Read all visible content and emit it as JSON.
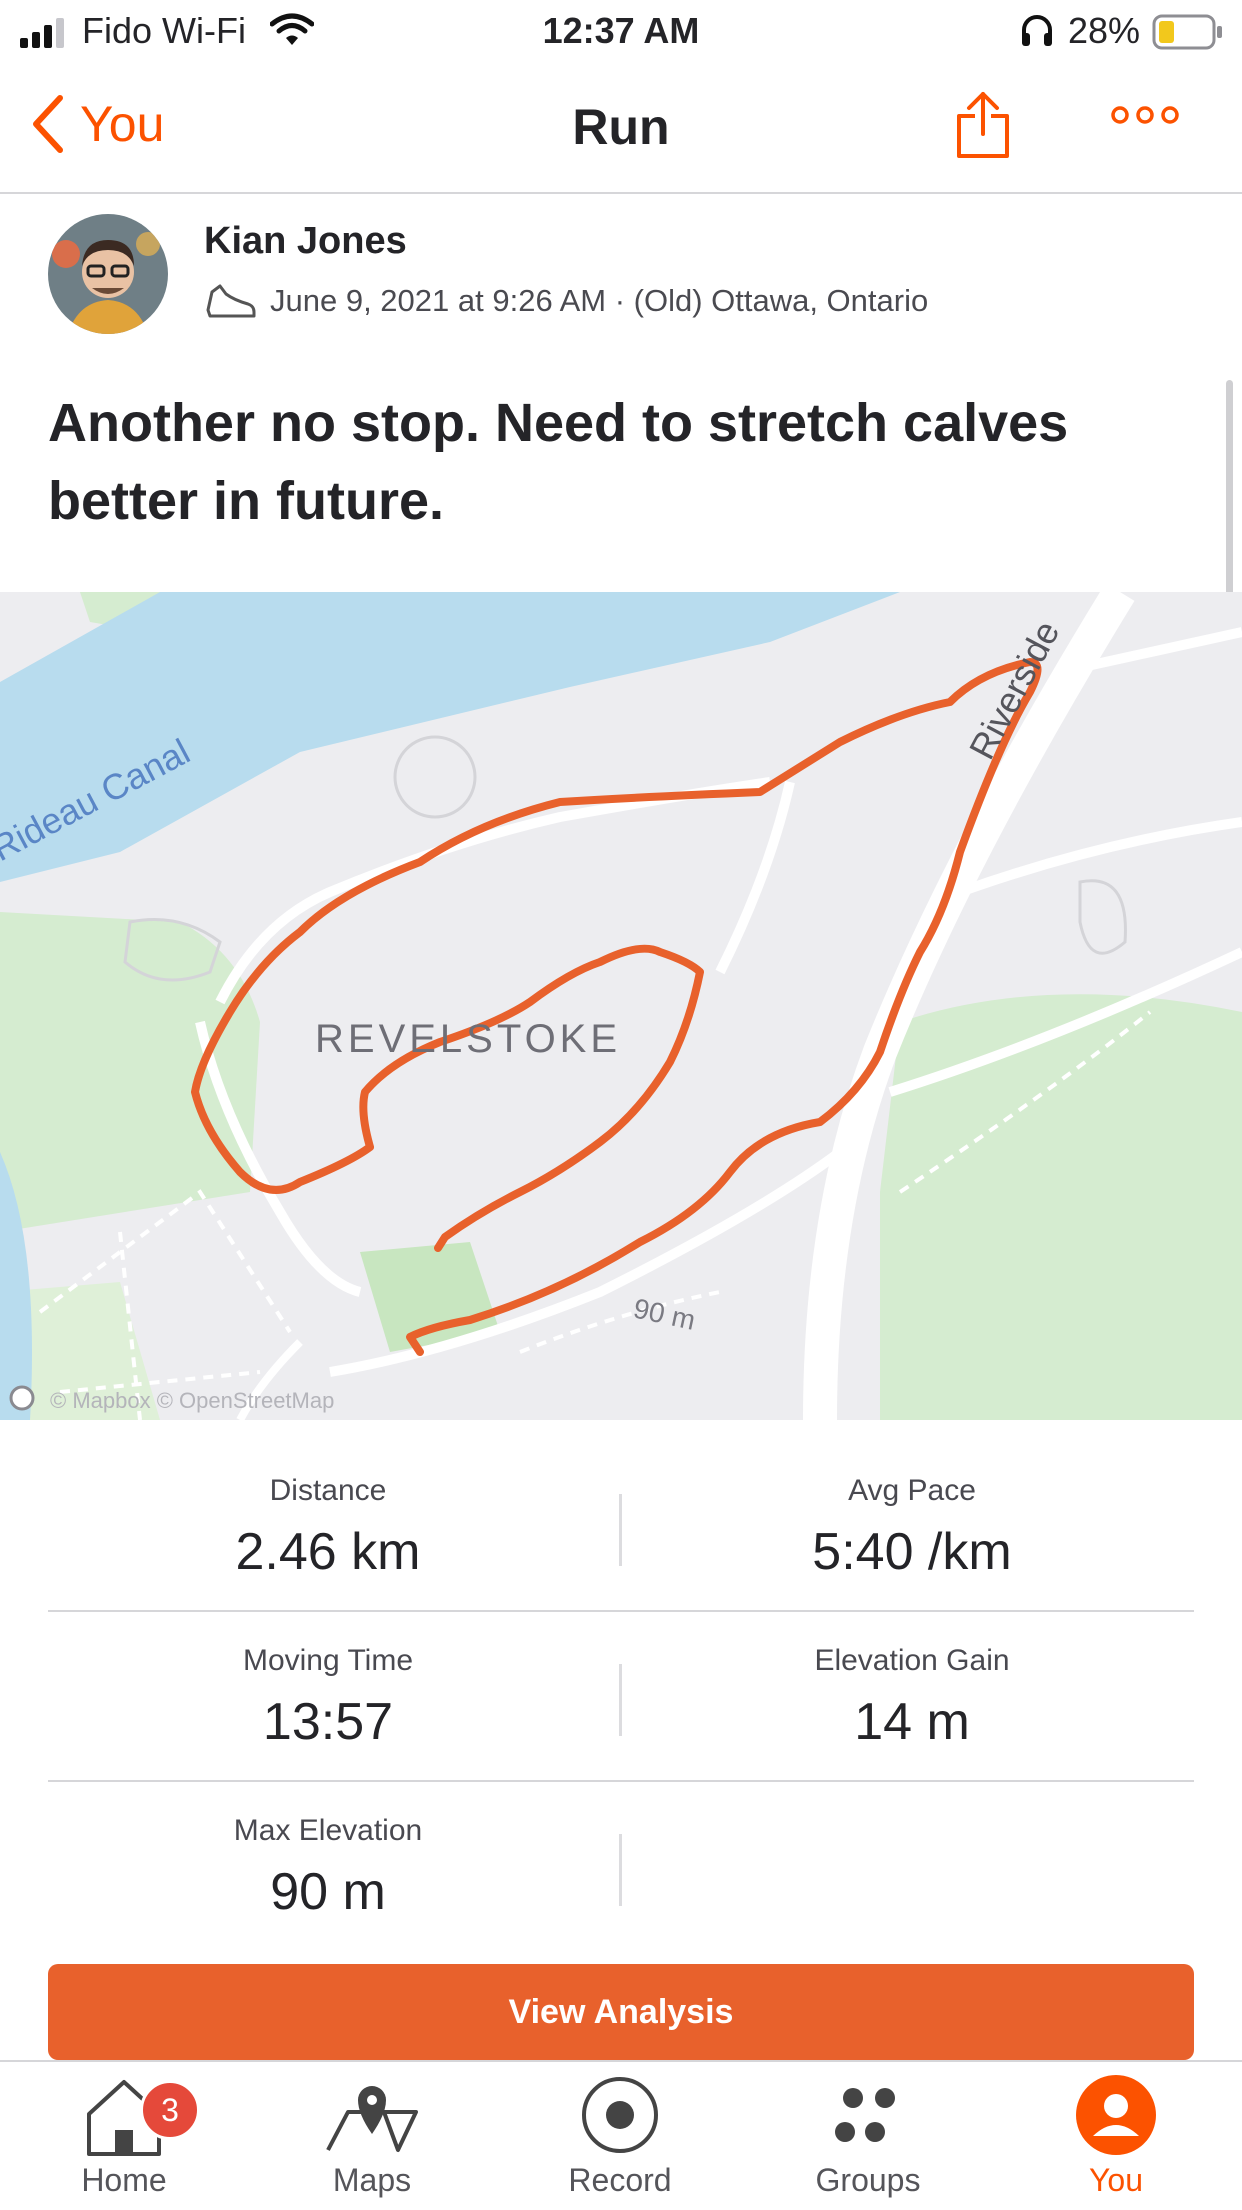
{
  "status_bar": {
    "carrier": "Fido Wi-Fi",
    "time": "12:37 AM",
    "battery": "28%"
  },
  "nav": {
    "back_label": "You",
    "title": "Run",
    "share_icon": "share-icon",
    "more_icon": "more-icon"
  },
  "activity": {
    "athlete_name": "Kian Jones",
    "sport_icon": "shoe-icon",
    "date_location": "June 9, 2021 at 9:26 AM · (Old) Ottawa, Ontario",
    "title": "Another no stop. Need to stretch calves better in future."
  },
  "map": {
    "water_label": "Rideau Canal",
    "area_label": "REVELSTOKE",
    "road_label": "Riverside",
    "elevation_label": "90 m",
    "attribution": "© Mapbox © OpenStreetMap",
    "route_color": "#e8612c",
    "water_color": "#b8dcee",
    "park_color": "#d5ecd0"
  },
  "stats": [
    {
      "label": "Distance",
      "value": "2.46 km"
    },
    {
      "label": "Avg Pace",
      "value": "5:40 /km"
    },
    {
      "label": "Moving Time",
      "value": "13:57"
    },
    {
      "label": "Elevation Gain",
      "value": "14 m"
    },
    {
      "label": "Max Elevation",
      "value": "90 m"
    }
  ],
  "button": {
    "label": "View Analysis"
  },
  "tabbar": {
    "home": "Home",
    "home_badge": "3",
    "maps": "Maps",
    "record": "Record",
    "groups": "Groups",
    "you": "You"
  },
  "colors": {
    "accent": "#fc5200",
    "button": "#e8612c",
    "badge": "#e5493a"
  }
}
